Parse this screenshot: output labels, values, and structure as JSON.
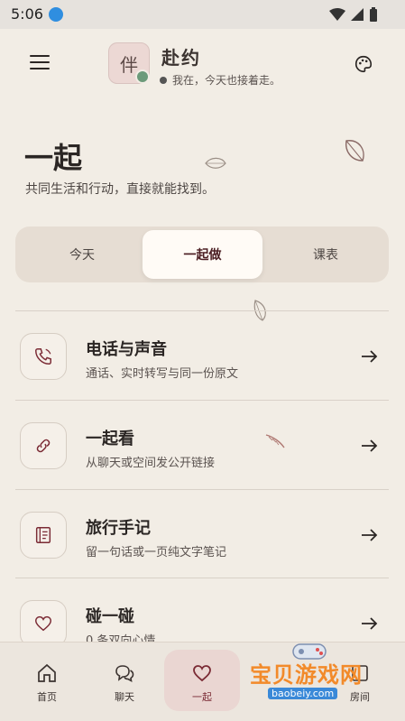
{
  "status_bar": {
    "time": "5:06"
  },
  "header": {
    "avatar_char": "伴",
    "app_name": "赴约",
    "status_text": "我在，今天也接着走。"
  },
  "page": {
    "title": "一起",
    "subtitle": "共同生活和行动，直接就能找到。"
  },
  "tabs": [
    {
      "label": "今天"
    },
    {
      "label": "一起做"
    },
    {
      "label": "课表"
    }
  ],
  "active_tab": "一起做",
  "items": [
    {
      "title": "电话与声音",
      "desc": "通话、实时转写与同一份原文",
      "icon": "phone-icon"
    },
    {
      "title": "一起看",
      "desc": "从聊天或空间发公开链接",
      "icon": "link-icon"
    },
    {
      "title": "旅行手记",
      "desc": "留一句话或一页纯文字笔记",
      "icon": "notebook-icon"
    },
    {
      "title": "碰一碰",
      "desc": "0 条双向心情",
      "icon": "heart-icon"
    }
  ],
  "bottom_nav": [
    {
      "label": "首页",
      "icon": "home-icon"
    },
    {
      "label": "聊天",
      "icon": "chat-icon"
    },
    {
      "label": "一起",
      "icon": "heart-icon"
    },
    {
      "label": "房间",
      "icon": "room-icon"
    }
  ],
  "watermark": {
    "text": "宝贝游戏网",
    "url": "baobeiy.com"
  },
  "colors": {
    "background": "#f2ede5",
    "accent": "#7b2b35",
    "online": "#6c9a7a"
  }
}
